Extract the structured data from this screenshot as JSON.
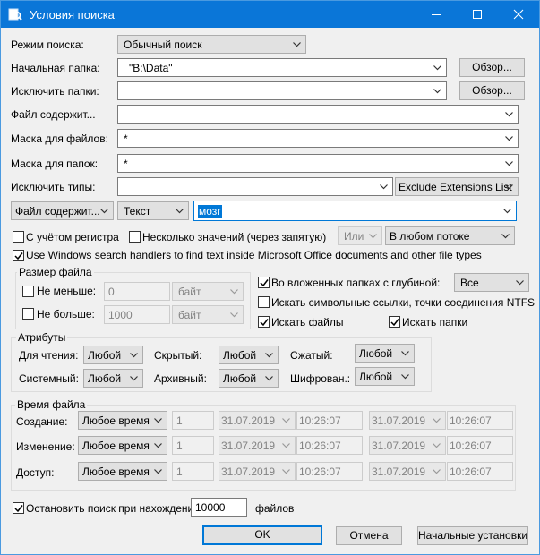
{
  "window": {
    "title": "Условия поиска"
  },
  "search_mode": {
    "label": "Режим поиска:",
    "value": "Обычный поиск"
  },
  "start_folder": {
    "label": "Начальная папка:",
    "value": "\"B:\\Data\"",
    "browse": "Обзор..."
  },
  "exclude_folders": {
    "label": "Исключить папки:",
    "value": "",
    "browse": "Обзор..."
  },
  "file_contains": {
    "label": "Файл содержит...",
    "value": ""
  },
  "file_mask": {
    "label": "Маска для файлов:",
    "value": "*"
  },
  "folder_mask": {
    "label": "Маска для папок:",
    "value": "*"
  },
  "exclude_types": {
    "label": "Исключить типы:",
    "value": "",
    "list": "Exclude Extensions List"
  },
  "content_row": {
    "target": "Файл содержит...",
    "mode": "Текст",
    "query": "мозг"
  },
  "options": {
    "case": "С учётом регистра",
    "multiple": "Несколько значений (через запятую)",
    "logic": "Или",
    "stream": "В любом потоке",
    "windows_handlers": "Use Windows search handlers to find text inside Microsoft Office documents and other file types"
  },
  "size": {
    "title": "Размер файла",
    "min_label": "Не меньше:",
    "min_value": "0",
    "min_unit": "байт",
    "max_label": "Не больше:",
    "max_value": "1000",
    "max_unit": "байт"
  },
  "depth": {
    "subfolders": "Во вложенных папках с глубиной:",
    "depth_value": "Все",
    "symlinks": "Искать символьные ссылки, точки соединения NTFS",
    "find_files": "Искать файлы",
    "find_folders": "Искать папки"
  },
  "attributes": {
    "title": "Атрибуты",
    "read_only": "Для чтения:",
    "read_only_value": "Любой",
    "hidden": "Скрытый:",
    "hidden_value": "Любой",
    "compressed": "Сжатый:",
    "compressed_value": "Любой",
    "system": "Системный:",
    "system_value": "Любой",
    "archive": "Архивный:",
    "archive_value": "Любой",
    "encrypted": "Шифрован.:",
    "encrypted_value": "Любой"
  },
  "file_time": {
    "title": "Время файла",
    "rows": [
      {
        "label": "Создание:",
        "mode": "Любое время",
        "count": "1",
        "date1": "31.07.2019",
        "time1": "10:26:07",
        "date2": "31.07.2019",
        "time2": "10:26:07"
      },
      {
        "label": "Изменение:",
        "mode": "Любое время",
        "count": "1",
        "date1": "31.07.2019",
        "time1": "10:26:07",
        "date2": "31.07.2019",
        "time2": "10:26:07"
      },
      {
        "label": "Доступ:",
        "mode": "Любое время",
        "count": "1",
        "date1": "31.07.2019",
        "time1": "10:26:07",
        "date2": "31.07.2019",
        "time2": "10:26:07"
      }
    ]
  },
  "stop": {
    "prefix": "Остановить поиск при нахождении",
    "value": "10000",
    "suffix": "файлов"
  },
  "buttons": {
    "ok": "OK",
    "cancel": "Отмена",
    "defaults": "Начальные установки"
  }
}
